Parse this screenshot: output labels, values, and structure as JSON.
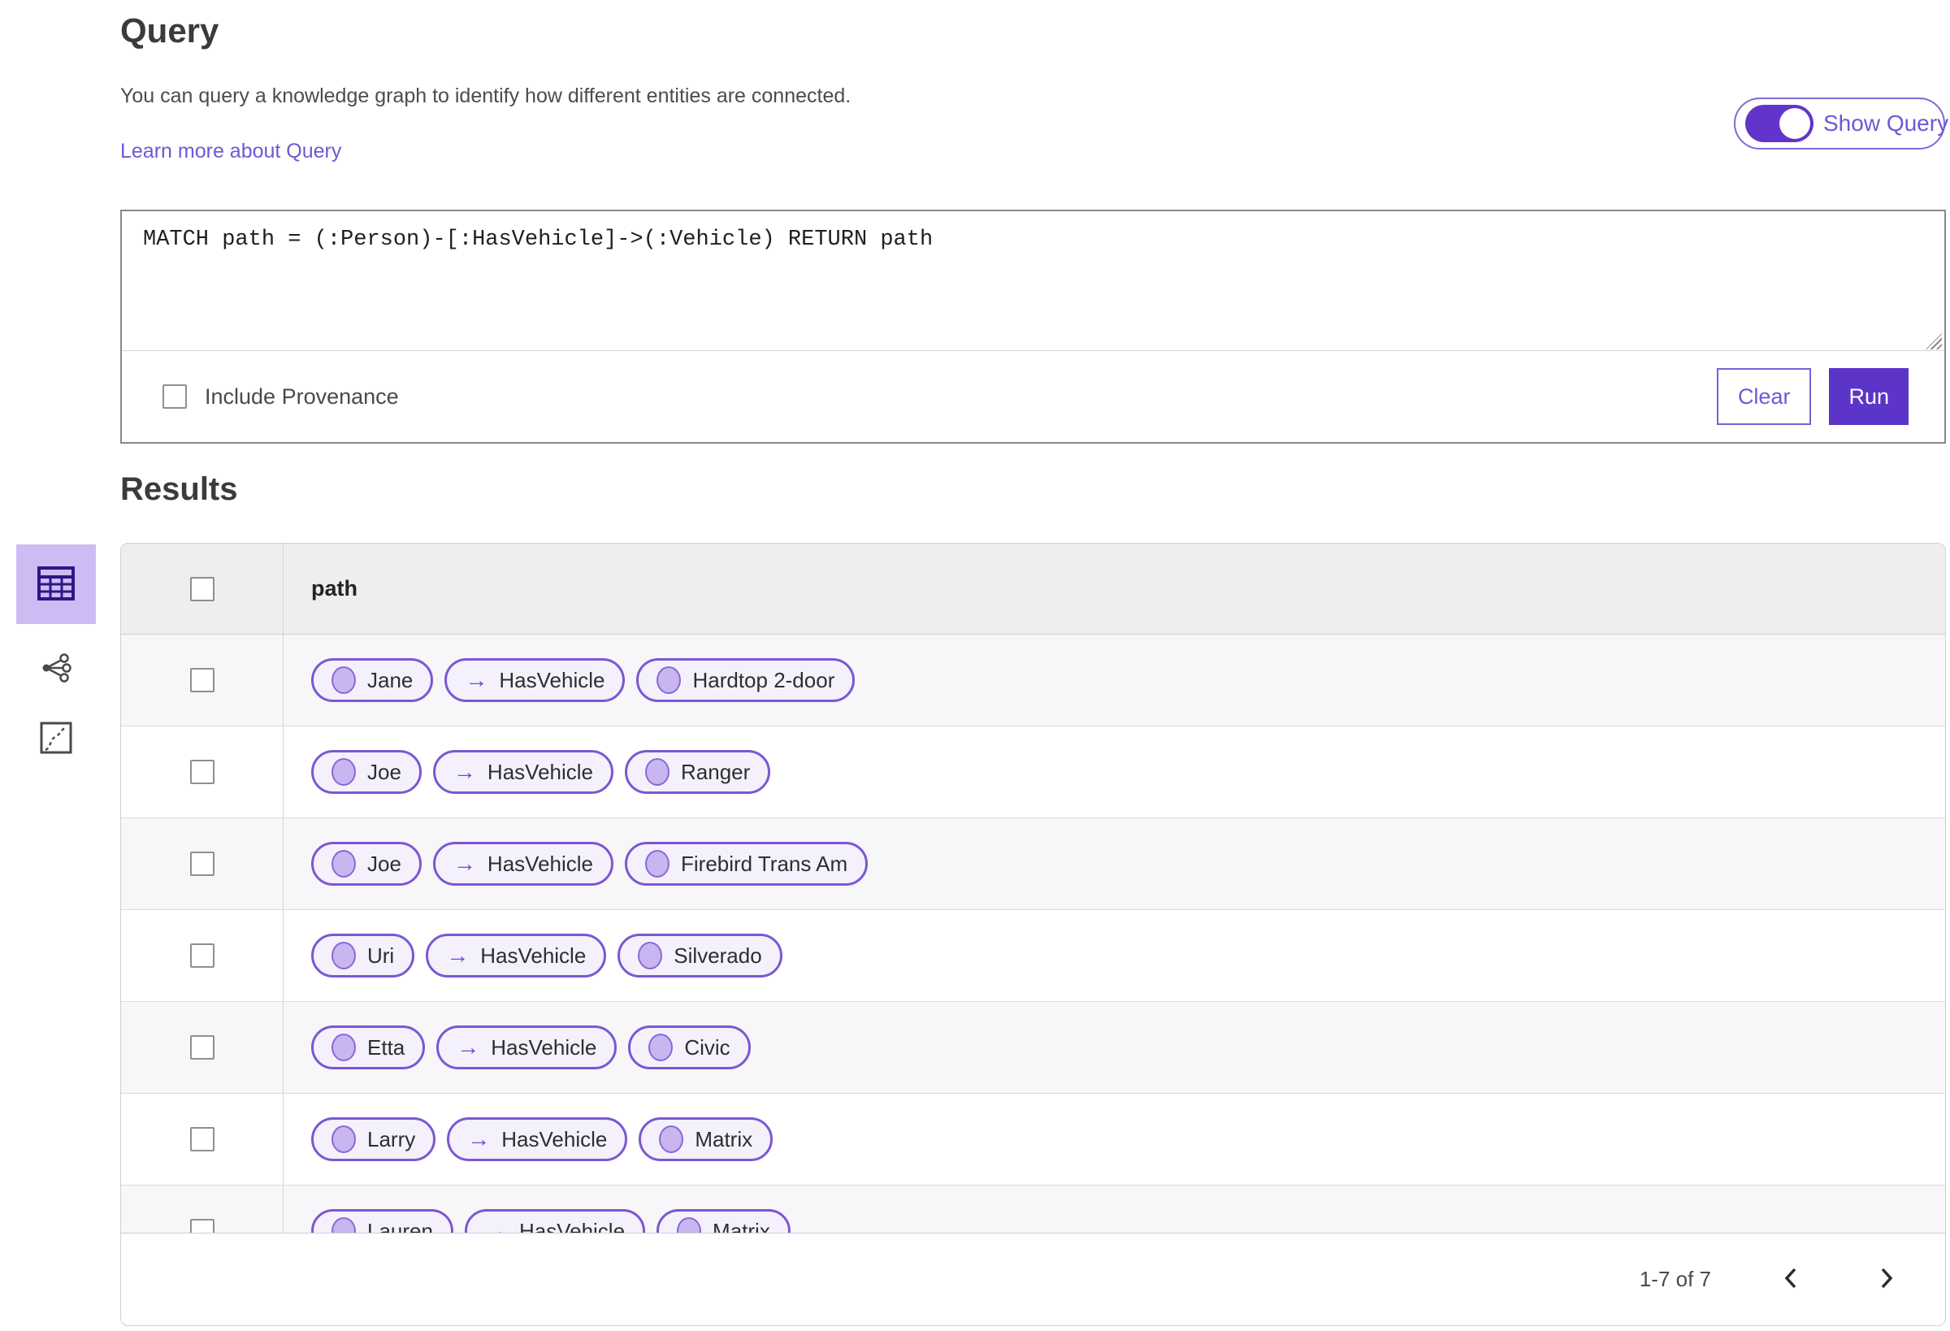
{
  "header": {
    "title": "Query",
    "description": "You can query a knowledge graph to identify how different entities are connected.",
    "learn_more_label": "Learn more about Query",
    "show_query_label": "Show Query",
    "show_query_on": true
  },
  "query_panel": {
    "query_text": "MATCH path = (:Person)-[:HasVehicle]->(:Vehicle) RETURN path",
    "include_provenance_label": "Include Provenance",
    "include_provenance_checked": false,
    "clear_label": "Clear",
    "run_label": "Run"
  },
  "results": {
    "title": "Results",
    "view_switcher": [
      {
        "name": "table-view",
        "icon": "table-icon",
        "selected": true
      },
      {
        "name": "link-chart-view",
        "icon": "link-chart-icon",
        "selected": false
      },
      {
        "name": "map-view",
        "icon": "map-icon",
        "selected": false
      }
    ],
    "table": {
      "column_header": "path",
      "rows": [
        {
          "source": "Jane",
          "relationship": "HasVehicle",
          "target": "Hardtop 2-door"
        },
        {
          "source": "Joe",
          "relationship": "HasVehicle",
          "target": "Ranger"
        },
        {
          "source": "Joe",
          "relationship": "HasVehicle",
          "target": "Firebird Trans Am"
        },
        {
          "source": "Uri",
          "relationship": "HasVehicle",
          "target": "Silverado"
        },
        {
          "source": "Etta",
          "relationship": "HasVehicle",
          "target": "Civic"
        },
        {
          "source": "Larry",
          "relationship": "HasVehicle",
          "target": "Matrix"
        },
        {
          "source": "Lauren",
          "relationship": "HasVehicle",
          "target": "Matrix"
        }
      ]
    },
    "pagination": {
      "range_label": "1-7 of 7"
    }
  },
  "icons": {
    "arrow_right": "→"
  },
  "colors": {
    "accent_purple": "#5C34C8",
    "toggle_purple": "#6334CB",
    "link_purple": "#6A5AD7",
    "pill_border": "#7B57D4",
    "pill_background": "#F4F1FC",
    "node_fill": "#C9B5EF",
    "node_border": "#8A68D8",
    "selected_view_background": "#CDBCF3",
    "table_header_background": "#EFEEEF",
    "row_alt_background": "#F7F6F8"
  }
}
